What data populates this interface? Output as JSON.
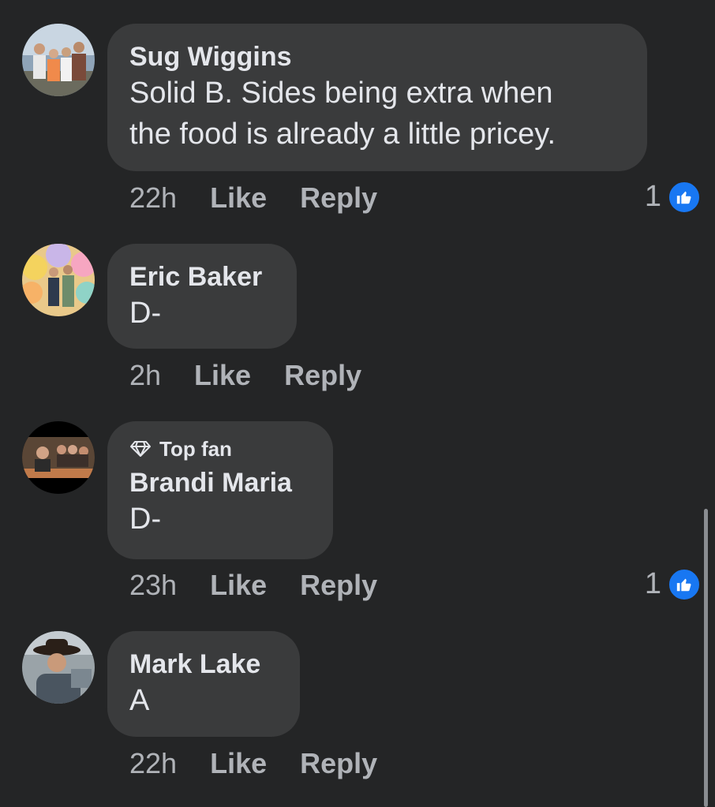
{
  "comments": [
    {
      "author": "Sug Wiggins",
      "text_lines": [
        "Solid B. Sides being extra when",
        "the food is already a little pricey."
      ],
      "time": "22h",
      "like_label": "Like",
      "reply_label": "Reply",
      "reaction_count": "1"
    },
    {
      "author": "Eric Baker",
      "text_lines": [
        "D-"
      ],
      "time": "2h",
      "like_label": "Like",
      "reply_label": "Reply"
    },
    {
      "badge": "Top fan",
      "author": "Brandi Maria",
      "text_lines": [
        "D-"
      ],
      "time": "23h",
      "like_label": "Like",
      "reply_label": "Reply",
      "reaction_count": "1"
    },
    {
      "author": "Mark Lake",
      "text_lines": [
        "A"
      ],
      "time": "22h",
      "like_label": "Like",
      "reply_label": "Reply"
    }
  ],
  "colors": {
    "background": "#242526",
    "bubble": "#3a3b3c",
    "text_primary": "#e4e6eb",
    "text_secondary": "#b0b3b8",
    "like_blue": "#1877f2"
  },
  "icons": {
    "badge": "diamond-icon",
    "reaction": "thumbs-up-icon"
  }
}
